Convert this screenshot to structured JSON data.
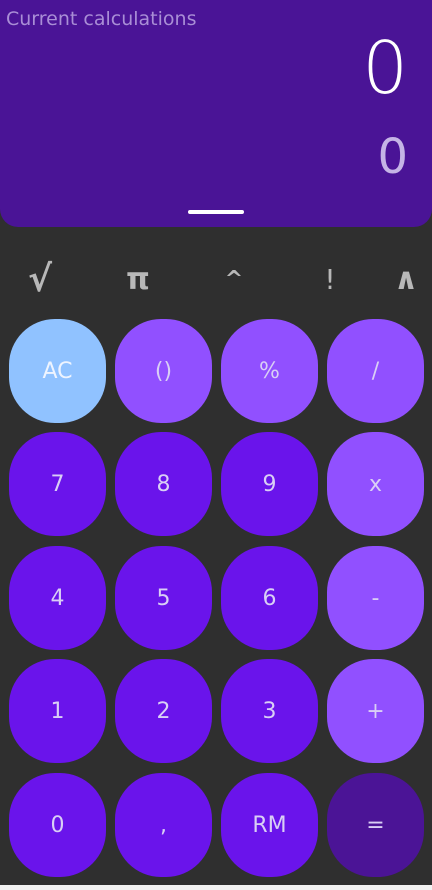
{
  "display": {
    "label": "Current calculations",
    "input": "0",
    "result": "0"
  },
  "scientific": {
    "sqrt": "√",
    "pi": "π",
    "power": "^",
    "factorial": "!",
    "expand": "∧"
  },
  "keypad": {
    "row1": [
      "AC",
      "()",
      "%",
      "/"
    ],
    "row2": [
      "7",
      "8",
      "9",
      "x"
    ],
    "row3": [
      "4",
      "5",
      "6",
      "-"
    ],
    "row4": [
      "1",
      "2",
      "3",
      "+"
    ],
    "row5": [
      "0",
      ",",
      "RM",
      "="
    ]
  },
  "colors": {
    "display_bg": "#4a1496",
    "number_key": "#6a14eb",
    "operator_key": "#9150ff",
    "clear_key": "#90c2ff",
    "equals_key": "#4b1496",
    "background": "#2f2f2f"
  }
}
